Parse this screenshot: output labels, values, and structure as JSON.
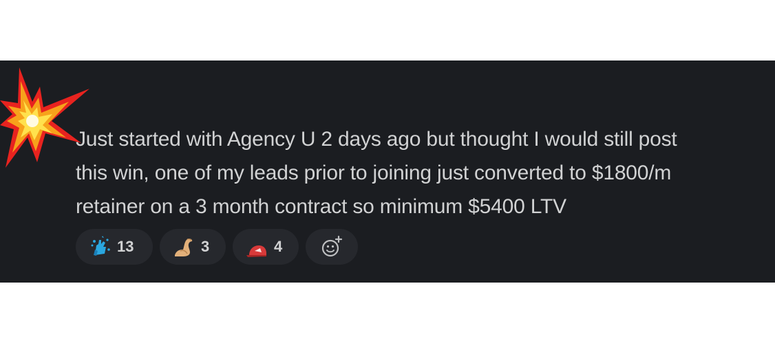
{
  "message": {
    "line1": "Just started with Agency U 2 days ago but thought I would still post",
    "line2": "this win, one of my leads prior to joining just converted to $1800/m",
    "line3": "retainer on a 3 month contract so minimum $5400 LTV"
  },
  "reactions": [
    {
      "icon": "raised-hands-splash-icon",
      "count": "13"
    },
    {
      "icon": "flexed-biceps-icon",
      "count": "3"
    },
    {
      "icon": "red-cap-icon",
      "count": "4"
    }
  ],
  "add_reaction": {
    "icon": "add-reaction-icon"
  },
  "decoration": {
    "icon": "collision-burst-icon"
  }
}
